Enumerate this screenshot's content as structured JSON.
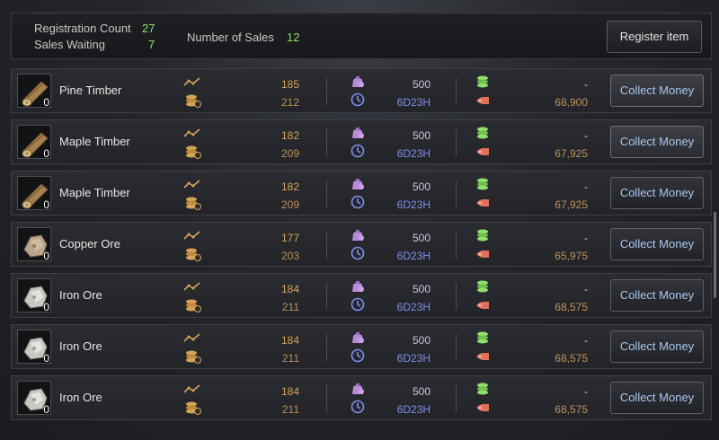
{
  "header": {
    "registration_count_label": "Registration Count",
    "registration_count": "27",
    "sales_waiting_label": "Sales Waiting",
    "sales_waiting": "7",
    "number_of_sales_label": "Number of Sales",
    "number_of_sales": "12",
    "register_button": "Register item"
  },
  "collect_label": "Collect Money",
  "rows": [
    {
      "name": "Pine Timber",
      "qty": "0",
      "icon": "log-icon",
      "price_a": "185",
      "price_b": "212",
      "count": "500",
      "time": "6D23H",
      "dash": "-",
      "money": "68,900"
    },
    {
      "name": "Maple Timber",
      "qty": "0",
      "icon": "log-icon",
      "price_a": "182",
      "price_b": "209",
      "count": "500",
      "time": "6D23H",
      "dash": "-",
      "money": "67,925"
    },
    {
      "name": "Maple Timber",
      "qty": "0",
      "icon": "log-icon",
      "price_a": "182",
      "price_b": "209",
      "count": "500",
      "time": "6D23H",
      "dash": "-",
      "money": "67,925"
    },
    {
      "name": "Copper Ore",
      "qty": "0",
      "icon": "copper-ore-icon",
      "price_a": "177",
      "price_b": "203",
      "count": "500",
      "time": "6D23H",
      "dash": "-",
      "money": "65,975"
    },
    {
      "name": "Iron Ore",
      "qty": "0",
      "icon": "iron-ore-icon",
      "price_a": "184",
      "price_b": "211",
      "count": "500",
      "time": "6D23H",
      "dash": "-",
      "money": "68,575"
    },
    {
      "name": "Iron Ore",
      "qty": "0",
      "icon": "iron-ore-icon",
      "price_a": "184",
      "price_b": "211",
      "count": "500",
      "time": "6D23H",
      "dash": "-",
      "money": "68,575"
    },
    {
      "name": "Iron Ore",
      "qty": "0",
      "icon": "iron-ore-icon",
      "price_a": "184",
      "price_b": "211",
      "count": "500",
      "time": "6D23H",
      "dash": "-",
      "money": "68,575"
    }
  ]
}
